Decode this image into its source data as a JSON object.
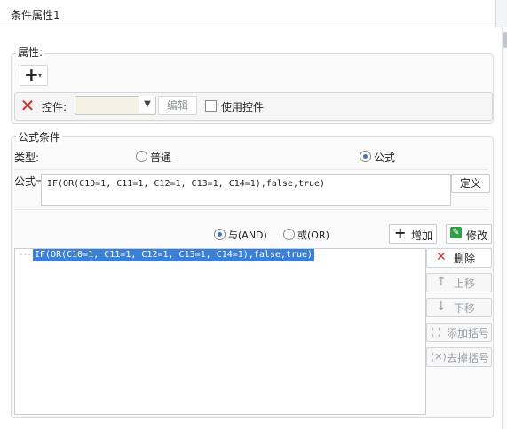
{
  "tab": {
    "title": "条件属性1"
  },
  "properties": {
    "section_label": "属性:",
    "add_symbol": "+",
    "control_label": "控件:",
    "edit_button": "编辑",
    "use_control_label": "使用控件"
  },
  "formula_condition": {
    "section_label": "公式条件",
    "type_label": "类型:",
    "type_options": [
      "普通",
      "公式"
    ],
    "selected_type": "公式",
    "formula_label": "公式=",
    "formula_value": "IF(OR(C10=1, C11=1, C12=1, C13=1, C14=1),false,true)",
    "define_button": "定义"
  },
  "logic": {
    "and_label": "与(AND)",
    "or_label": "或(OR)",
    "selected": "与(AND)",
    "add_button": "增加",
    "modify_button": "修改"
  },
  "conditions_list": {
    "items": [
      "IF(OR(C10=1, C11=1, C12=1, C13=1, C14=1),false,true)"
    ],
    "tree_connector": "---"
  },
  "side_buttons": {
    "delete": "删除",
    "move_up": "上移",
    "move_down": "下移",
    "add_bracket": "添加括号",
    "remove_bracket": "去掉括号"
  }
}
